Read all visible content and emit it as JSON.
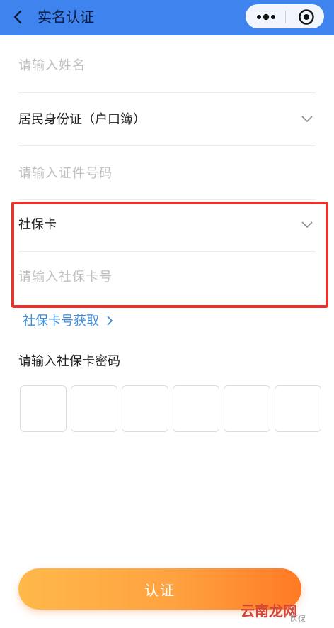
{
  "header": {
    "back_icon": "chevron-left-icon",
    "title": "实名认证",
    "more_icon": "more-dots-icon",
    "close_icon": "target-icon",
    "color": "#3f84ee"
  },
  "form": {
    "name_placeholder": "请输入姓名",
    "id_type_value": "居民身份证（户口簿）",
    "id_number_placeholder": "请输入证件号码",
    "card_type_value": "社保卡",
    "card_number_placeholder": "请输入社保卡号",
    "card_link": "社保卡号获取",
    "password_label": "请输入社保卡密码",
    "pin_count": 6
  },
  "submit": {
    "label": "认证"
  },
  "watermark": {
    "text": "云南龙网",
    "small": "医保"
  }
}
